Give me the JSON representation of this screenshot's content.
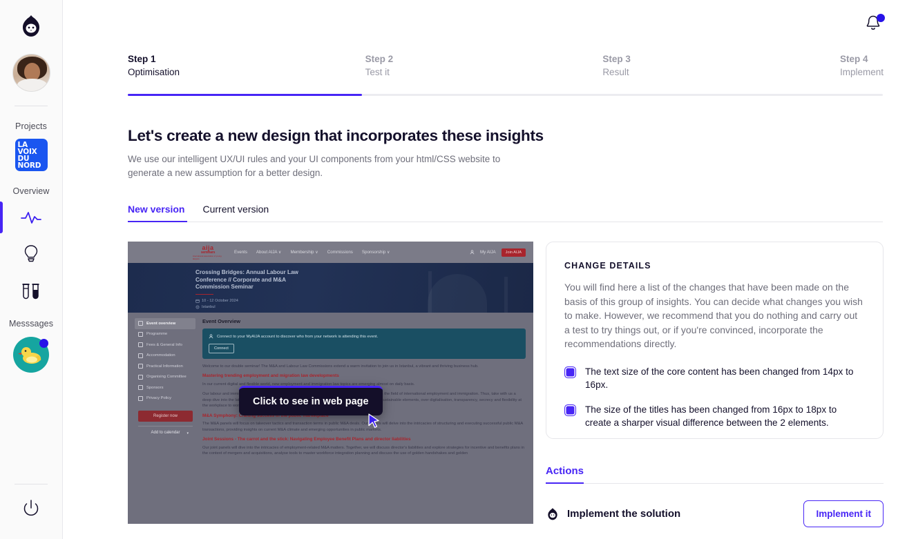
{
  "rail": {
    "logo_icon": "flame-cat-logo",
    "user_avatar_alt": "user-avatar",
    "projects_label": "Projects",
    "project_logo_lines": [
      "LA",
      "VOIX",
      "DU",
      "NORD"
    ],
    "overview_label": "Overview",
    "icons": [
      {
        "name": "activity-pulse-icon",
        "active": true
      },
      {
        "name": "lightbulb-icon",
        "active": false
      },
      {
        "name": "test-tubes-icon",
        "active": false
      }
    ],
    "messages_label": "Messsages",
    "messages_avatar": "duck-avatar",
    "power_icon": "power-icon",
    "accent": "#4725f5"
  },
  "header": {
    "bell_icon": "notification-bell-icon",
    "bell_has_dot": true
  },
  "stepper": {
    "steps": [
      {
        "num": "Step 1",
        "name": "Optimisation",
        "active": true
      },
      {
        "num": "Step 2",
        "name": "Test it",
        "active": false
      },
      {
        "num": "Step 3",
        "name": "Result",
        "active": false
      },
      {
        "num": "Step 4",
        "name": "Implement",
        "active": false
      }
    ],
    "progress_percent": 31
  },
  "page": {
    "title": "Let's create a new design that incorporates these insights",
    "subtitle": "We use our intelligent UX/UI rules and your UI components from your html/CSS website to generate a new assumption for a better design."
  },
  "tabs": [
    {
      "label": "New version",
      "active": true
    },
    {
      "label": "Current version",
      "active": false
    }
  ],
  "preview": {
    "tooltip": "Click to see in web page",
    "nav": {
      "brand_line1": "aija",
      "brand_line2": "seminars",
      "brand_line3": "international association of young lawyers",
      "items": [
        "Events",
        "About AIJA ∨",
        "Membership ∨",
        "Commissions",
        "Sponsorship ∨"
      ],
      "my_account": "My AIJA",
      "join_label": "Join AIJA"
    },
    "hero": {
      "title": "Crossing Bridges: Annual Labour Law Conference // Corporate and M&A Commission Seminar",
      "date": "10 - 12 October 2024",
      "location": "Istanbul"
    },
    "sidebar_items": [
      {
        "label": "Event overview",
        "selected": true
      },
      {
        "label": "Programme",
        "selected": false
      },
      {
        "label": "Fees & General Info",
        "selected": false
      },
      {
        "label": "Accommodation",
        "selected": false
      },
      {
        "label": "Practical Information",
        "selected": false
      },
      {
        "label": "Organising Committee",
        "selected": false
      },
      {
        "label": "Sponsors",
        "selected": false
      },
      {
        "label": "Privacy Policy",
        "selected": false
      }
    ],
    "register_label": "Register now",
    "calendar_label": "Add to calendar",
    "content": {
      "heading": "Event Overview",
      "connect_text": "Connect to your MyAIJA account to discover who from your network is attending this event.",
      "connect_button": "Connect",
      "intro": "Welcome to our double seminar! The M&A and Labour Law Commissions extend a warm invitation to join us in Istanbul, a vibrant and thriving business hub.",
      "section1_title": "Mastering trending employment and migration law developments",
      "section1_p1": "In our current digital and flexible world, new employment and immigration law topics are emerging almost on daily basis.",
      "section1_p2": "Our labour and immigration law panels will offer you discussions on a wide variety of trending topics in the field of international employment and immigration. Thus, take with us a deep dive into the latest employment and immigration law developments, ranging from implementing sustainable elements, over digitalisation, transparency, secrecy and flexibility at the workplace to working across borders.",
      "section2_title": "M&A Symphony: Crafting success in the public marketplace",
      "section2_p1": "The M&A panels will focus on takeover tactics and transaction terms in public M&A deals. Our panels will delve into the intricacies of structuring and executing successful public M&A transactions, providing insights on current M&A climate and emerging opportunities in public markets.",
      "section3_title": "Joint  Sessions - The carrot and the stick: Navigating Employee Benefit Plans and director liabilities",
      "section3_p1": "Our joint panels will dive into the intricacies of employment-related M&A matters. Together, we will discuss director's liabilities and explore strategies for incentive and benefits plans in the context of mergers and acquisitions, analyse tools to master workforce integration planning and discuss the use of golden handshakes and golden"
    }
  },
  "change_details": {
    "title": "CHANGE DETAILS",
    "body": "You will find here a list of the changes that have been made on the basis of this group of insights. You can decide what changes you wish to make. However, we recommend that you do nothing and carry out a test to try things out, or if you're convinced, incorporate the recommendations directly.",
    "items": [
      "The text size of the core content has been changed from 14px to 16px.",
      "The size of the titles has been changed from 16px to 18px to create a sharper visual difference between the 2 elements."
    ]
  },
  "actions": {
    "title": "Actions",
    "row_icon": "flame-cat-logo",
    "row_label": "Implement the solution",
    "button_label": "Implement it"
  }
}
